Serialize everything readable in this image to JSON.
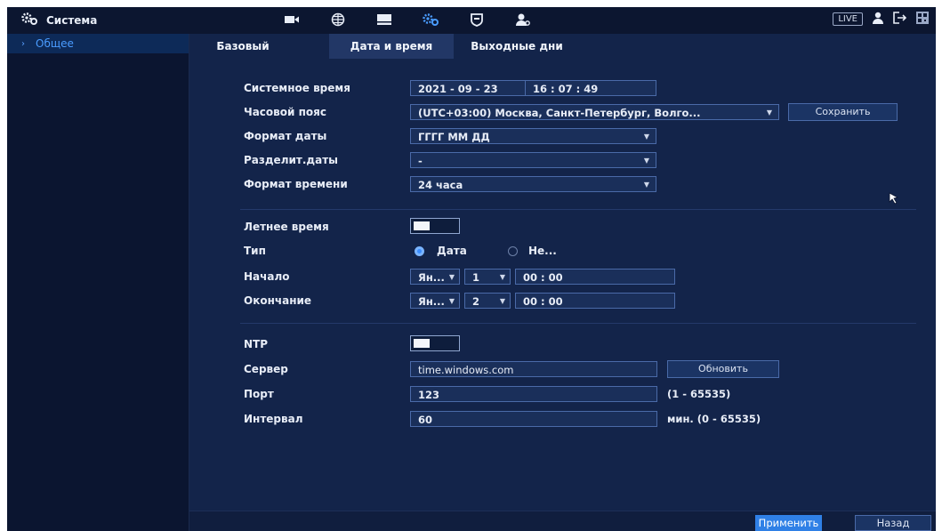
{
  "header": {
    "title": "Система",
    "live_label": "LIVE"
  },
  "sidebar": {
    "items": [
      {
        "label": "Общее",
        "active": true
      }
    ]
  },
  "tabs": [
    {
      "label": "Базовый",
      "active": false
    },
    {
      "label": "Дата и время",
      "active": true
    },
    {
      "label": "Выходные дни",
      "active": false
    }
  ],
  "form": {
    "system_time": {
      "label": "Системное время",
      "date": "2021 - 09 - 23",
      "time": "16 : 07 : 49"
    },
    "timezone": {
      "label": "Часовой пояс",
      "value": "(UTC+03:00) Москва, Санкт-Петербург, Волго...",
      "save_label": "Сохранить"
    },
    "date_format": {
      "label": "Формат даты",
      "value": "ГГГГ ММ ДД"
    },
    "date_separator": {
      "label": "Разделит.даты",
      "value": "-"
    },
    "time_format": {
      "label": "Формат времени",
      "value": "24 часа"
    },
    "dst": {
      "label": "Летнее время",
      "enabled": true
    },
    "type": {
      "label": "Тип",
      "options": [
        "Дата",
        "Не..."
      ],
      "selected": "Дата"
    },
    "start": {
      "label": "Начало",
      "month": "Ян...",
      "day": "1",
      "time": "00 : 00"
    },
    "end": {
      "label": "Окончание",
      "month": "Ян...",
      "day": "2",
      "time": "00 : 00"
    },
    "ntp": {
      "label": "NTP",
      "enabled": true
    },
    "server": {
      "label": "Сервер",
      "value": "time.windows.com",
      "update_label": "Обновить"
    },
    "port": {
      "label": "Порт",
      "value": "123",
      "range": "(1 - 65535)"
    },
    "interval": {
      "label": "Интервал",
      "value": "60",
      "range": "мин.  (0 - 65535)"
    }
  },
  "footer": {
    "apply_label": "Применить",
    "back_label": "Назад"
  },
  "colors": {
    "accent": "#2f80e6",
    "background": "#13244a",
    "active_tab": "#223766"
  }
}
